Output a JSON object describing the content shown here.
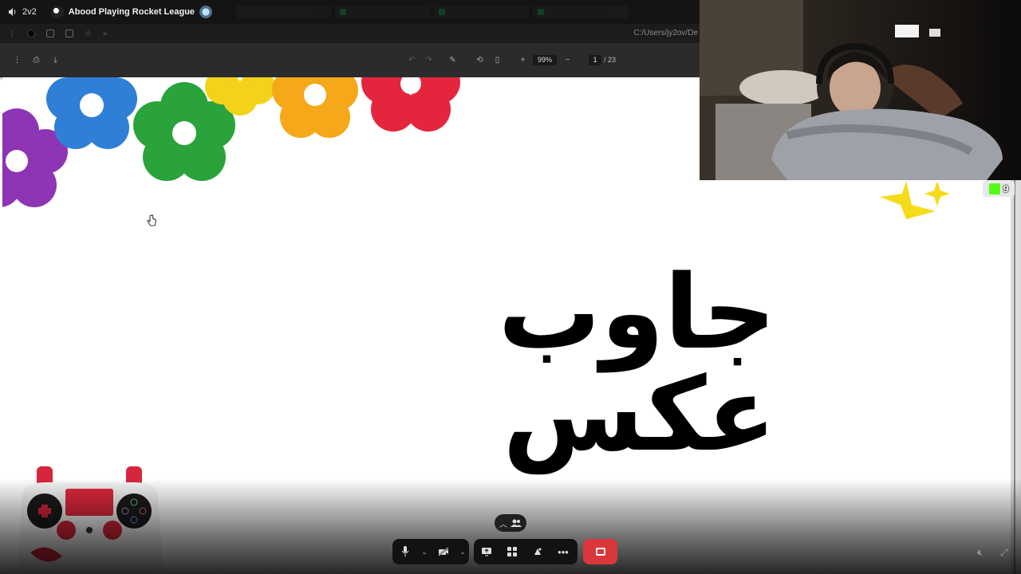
{
  "voice": {
    "channel": "2v2"
  },
  "stream": {
    "title": "Abood Playing Rocket League"
  },
  "browser": {
    "path": "C:/Users/jy2ov/De"
  },
  "pdf": {
    "zoom": "99%",
    "page": "1",
    "total": "/ 23"
  },
  "slide": {
    "headline": "جاوب عكس"
  },
  "viewers": {
    "count": "9"
  },
  "icons": {
    "speaker": "speaker-icon",
    "mic": "microphone-icon",
    "camera": "camera-off-icon",
    "share": "screen-share-icon",
    "activities": "activities-icon",
    "soundboard": "soundboard-icon",
    "more": "more-icon",
    "leave": "leave-call-icon"
  },
  "colors": {
    "leave": "#da373c",
    "kick": "#53fc18",
    "discordbar": "#111214"
  }
}
